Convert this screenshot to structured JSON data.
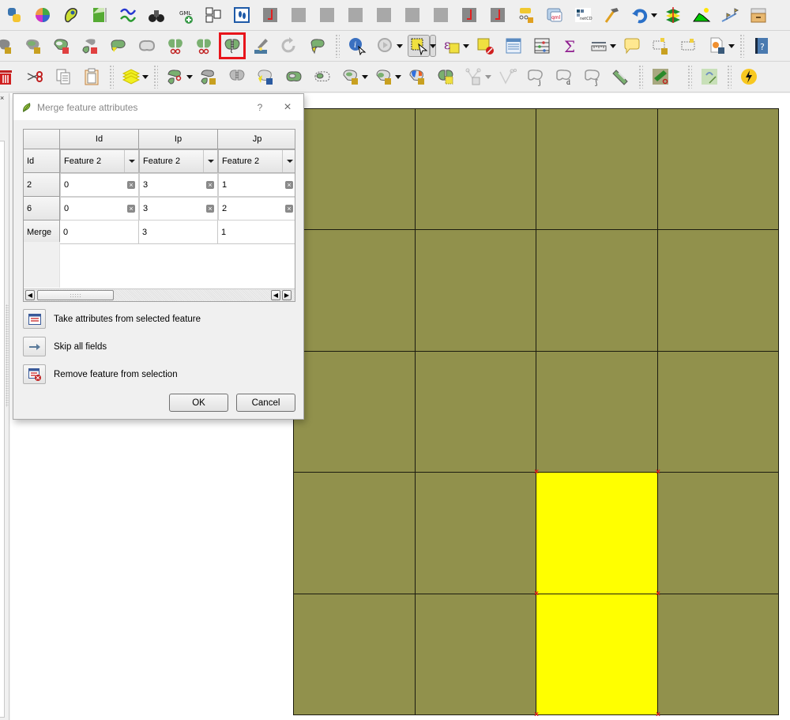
{
  "toolbars": {
    "row1": [
      "python-console",
      "color-wheel",
      "contour",
      "raster-terrain",
      "line-generalize",
      "binoculars-search",
      "gml-add",
      "db-manager",
      "footprint",
      "grid-plugin-red",
      "grid-plugin",
      "grid-plugin",
      "grid-plugin",
      "grid-plugin",
      "grid-plugin",
      "grid-plugin-red",
      "grid-plugin-red",
      "label-tool",
      "qml-plugin",
      "netcdf",
      "hammer",
      "undo",
      "layers-sync",
      "terrain-profile",
      "route-flags",
      "archive"
    ],
    "row2": [
      "add-ring-polygon",
      "add-part-polygon",
      "delete-ring",
      "delete-part",
      "reshape-feature",
      "offset-curve",
      "split-features",
      "split-parts",
      "merge-features",
      "node-tool-pen",
      "rotate-feature",
      "simplify-feature",
      "identify-features",
      "run-action",
      "select-features",
      "select-by-expression",
      "deselect-all",
      "open-attribute-table",
      "field-calculator",
      "statistical-summary",
      "measure-line",
      "map-tips",
      "new-bookmark",
      "show-bookmarks",
      "save-as-image",
      "help-contents"
    ],
    "row3": [
      "delete-selected",
      "cut-features",
      "copy-features",
      "paste-features",
      "styling-manager",
      "split-features-dropdown",
      "split-parts-dropdown",
      "merge-attributes",
      "fill-ring",
      "add-ring",
      "delete-ring-dashed",
      "add-feature-dropdown",
      "add-feature-gradient",
      "rotate-point-symbol",
      "vertex-editor",
      "digitize-line",
      "trace-j",
      "trace-d",
      "trace-f",
      "zoom-to-selection",
      "cut-map-tool",
      "map-swipe",
      "quick-plugin"
    ]
  },
  "left_panel": {
    "close_glyph": "×"
  },
  "dialog": {
    "title": "Merge feature attributes",
    "help_glyph": "?",
    "close_glyph": "×",
    "table": {
      "corner": "",
      "columns": [
        "Id",
        "Ip",
        "Jp"
      ],
      "strategy_row": {
        "header": "Id",
        "values": [
          "Feature 2",
          "Feature 2",
          "Feature 2"
        ]
      },
      "feature_rows": [
        {
          "header": "2",
          "values": [
            "0",
            "3",
            "1"
          ]
        },
        {
          "header": "6",
          "values": [
            "0",
            "3",
            "2"
          ]
        }
      ],
      "merge_row": {
        "header": "Merge",
        "values": [
          "0",
          "3",
          "1"
        ]
      }
    },
    "scrollbar": {
      "left_arrow": "◀",
      "right_arrow_left": "◀",
      "right_arrow_right": "▶"
    },
    "actions": [
      {
        "label": "Take attributes from selected feature",
        "icon": "table-select-icon"
      },
      {
        "label": "Skip all fields",
        "icon": "arrow-right-icon"
      },
      {
        "label": "Remove feature from selection",
        "icon": "table-remove-icon"
      }
    ],
    "ok_label": "OK",
    "cancel_label": "Cancel"
  },
  "map": {
    "grid_columns": 4,
    "grid_rows": 5,
    "fill_color": "#91914c",
    "selected_color": "#ffff00",
    "outline_color": "#1c1c10",
    "vertex_marker_color": "#e8141b",
    "selected_cells": [
      {
        "row": 3,
        "col": 2
      },
      {
        "row": 4,
        "col": 2
      }
    ],
    "vertex_marker_glyph": "×"
  }
}
